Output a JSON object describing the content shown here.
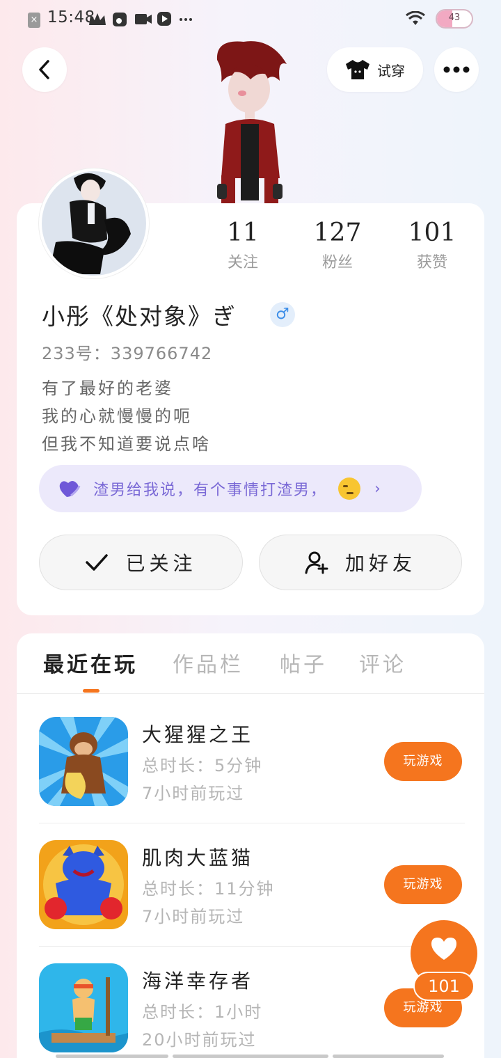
{
  "status_bar": {
    "time": "15:48",
    "battery": "43",
    "battery_level": 0.43
  },
  "header": {
    "try_on_label": "试穿"
  },
  "profile": {
    "stats": [
      {
        "value": "11",
        "label": "关注"
      },
      {
        "value": "127",
        "label": "粉丝"
      },
      {
        "value": "101",
        "label": "获赞"
      }
    ],
    "username": "小彤《处对象》ぎ",
    "gender_symbol": "♂",
    "uid": "233号：339766742",
    "bio": [
      "有了最好的老婆",
      "我的心就慢慢的呃",
      "但我不知道要说点啥"
    ],
    "quote": "渣男给我说，有个事情打渣男，",
    "follow_label": "已关注",
    "add_friend_label": "加好友"
  },
  "tabs": [
    {
      "label": "最近在玩",
      "active": true
    },
    {
      "label": "作品栏",
      "active": false
    },
    {
      "label": "帖子",
      "active": false
    },
    {
      "label": "评论",
      "active": false
    }
  ],
  "games": [
    {
      "name": "大猩猩之王",
      "duration": "总时长：5分钟",
      "last_played": "7小时前玩过",
      "play_label": "玩游戏",
      "icon": "gorilla-game-icon"
    },
    {
      "name": "肌肉大蓝猫",
      "duration": "总时长：11分钟",
      "last_played": "7小时前玩过",
      "play_label": "玩游戏",
      "icon": "blue-cat-game-icon"
    },
    {
      "name": "海洋幸存者",
      "duration": "总时长：1小时",
      "last_played": "20小时前玩过",
      "play_label": "玩游戏",
      "icon": "ocean-survivor-game-icon"
    }
  ],
  "like_fab": {
    "count": "101"
  },
  "colors": {
    "accent": "#f5751e",
    "quote_bg": "#ece9fb",
    "quote_text": "#7a69d6"
  }
}
